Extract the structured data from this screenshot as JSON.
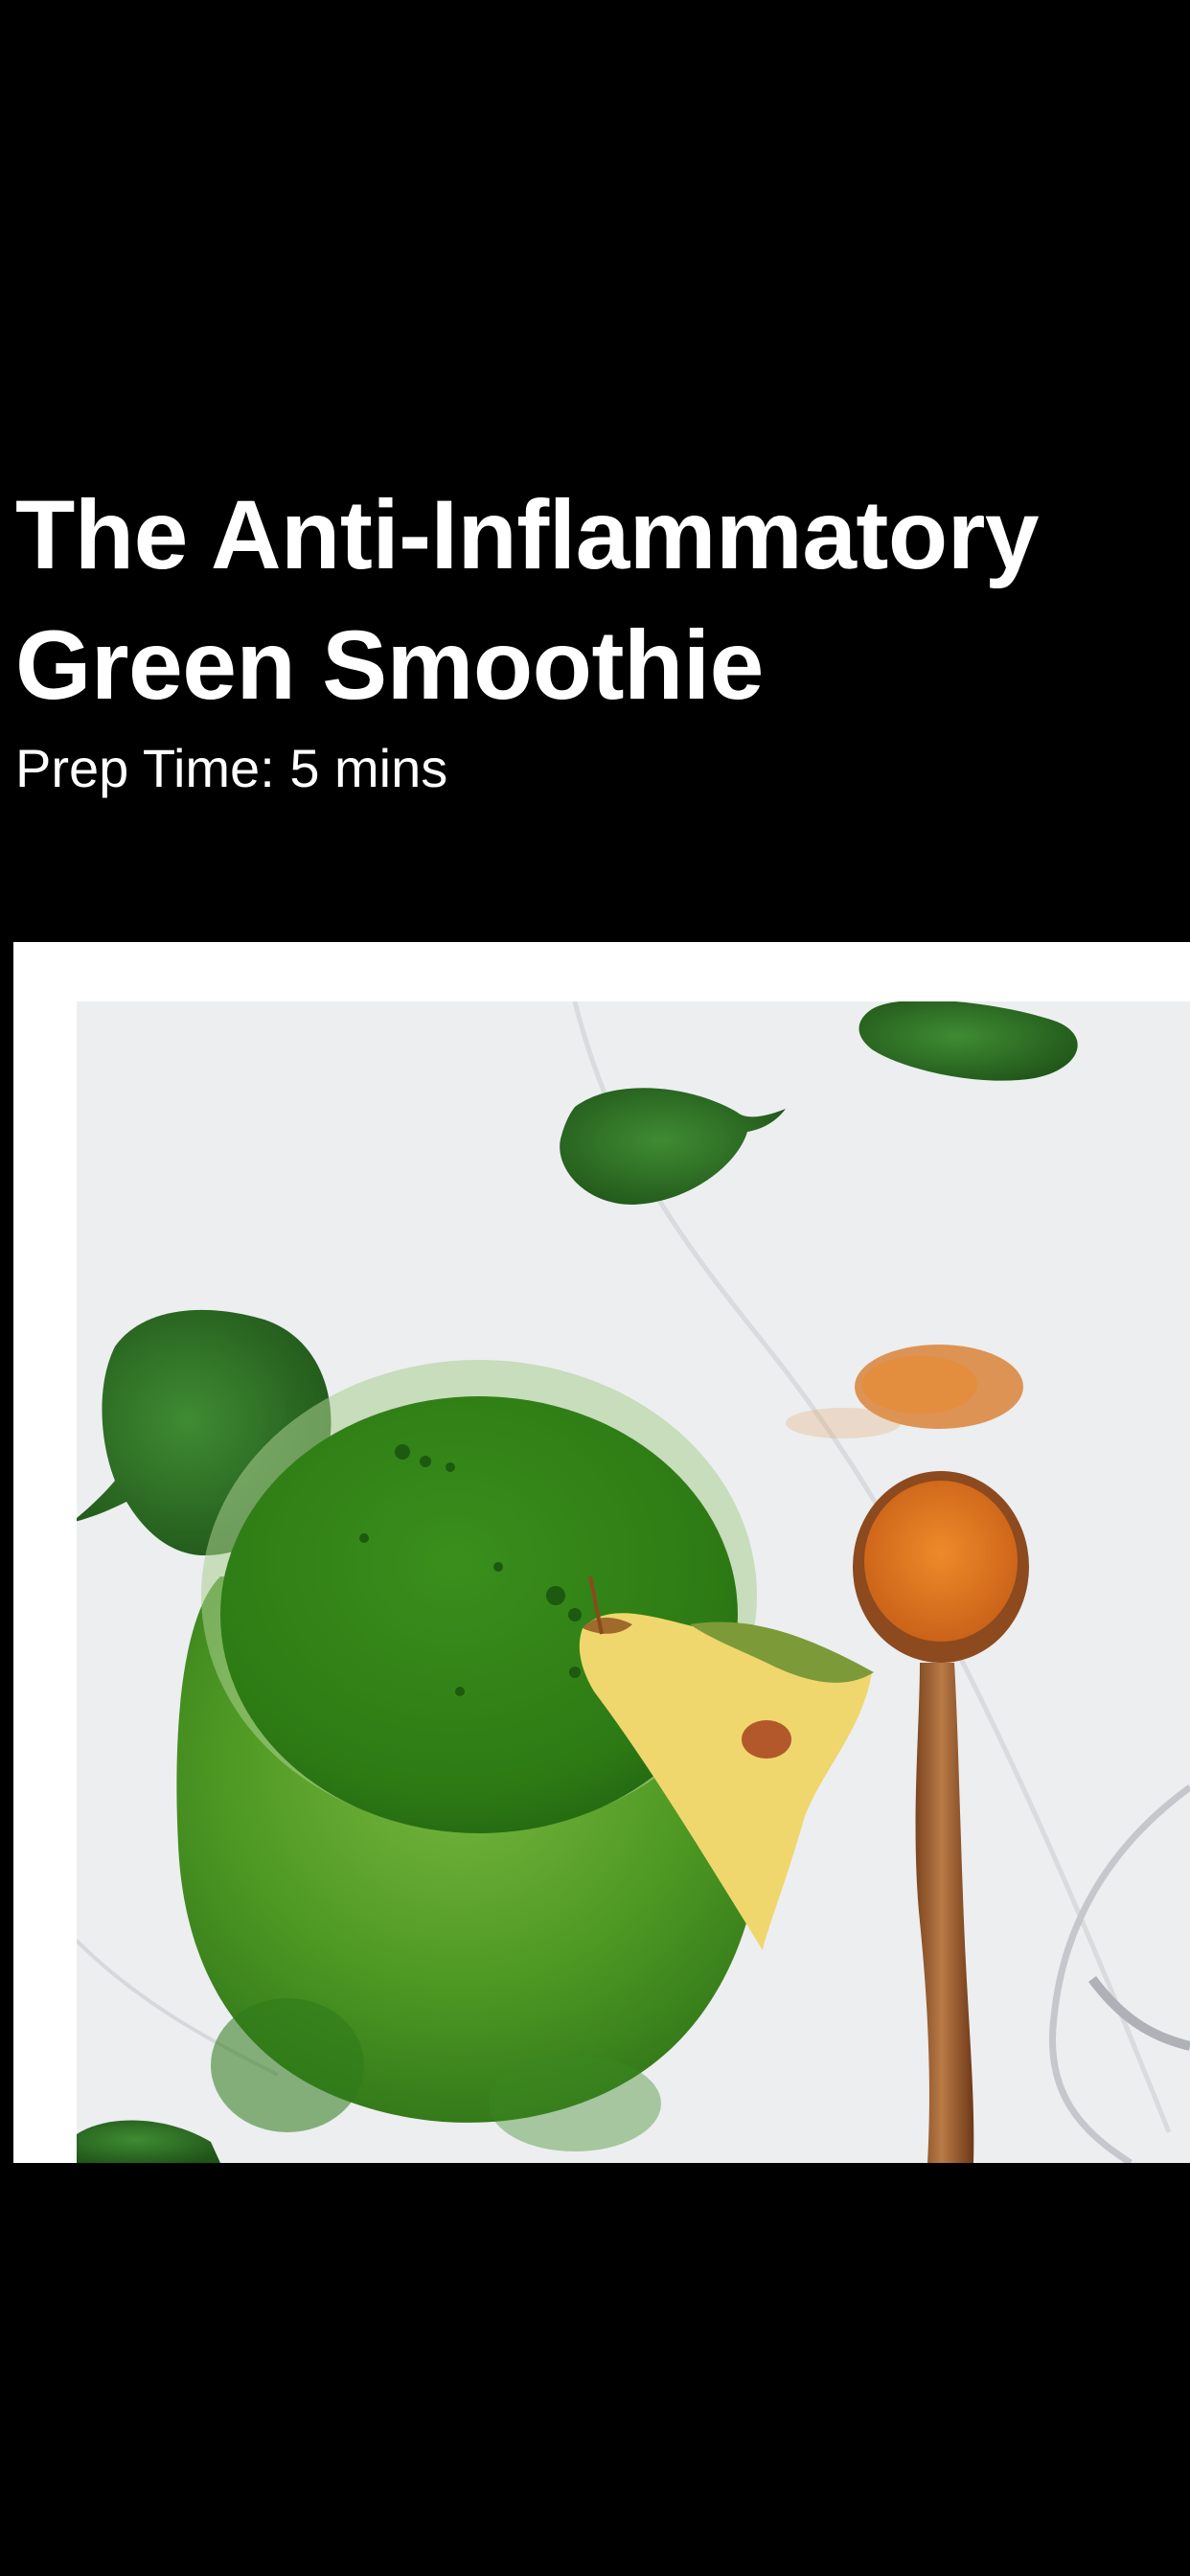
{
  "recipe": {
    "title_line1": "The Anti-Inflammatory",
    "title_line2": "Green Smoothie",
    "prep_time": "Prep Time: 5 mins"
  },
  "photo": {
    "icon": "smoothie-photo",
    "colors": {
      "marble": "#eceef0",
      "smoothie": "#4f9a24",
      "spinach": "#2e6b23",
      "turmeric": "#d8741f",
      "spoon": "#9b5a2c",
      "pineapple": "#efd76d"
    }
  }
}
